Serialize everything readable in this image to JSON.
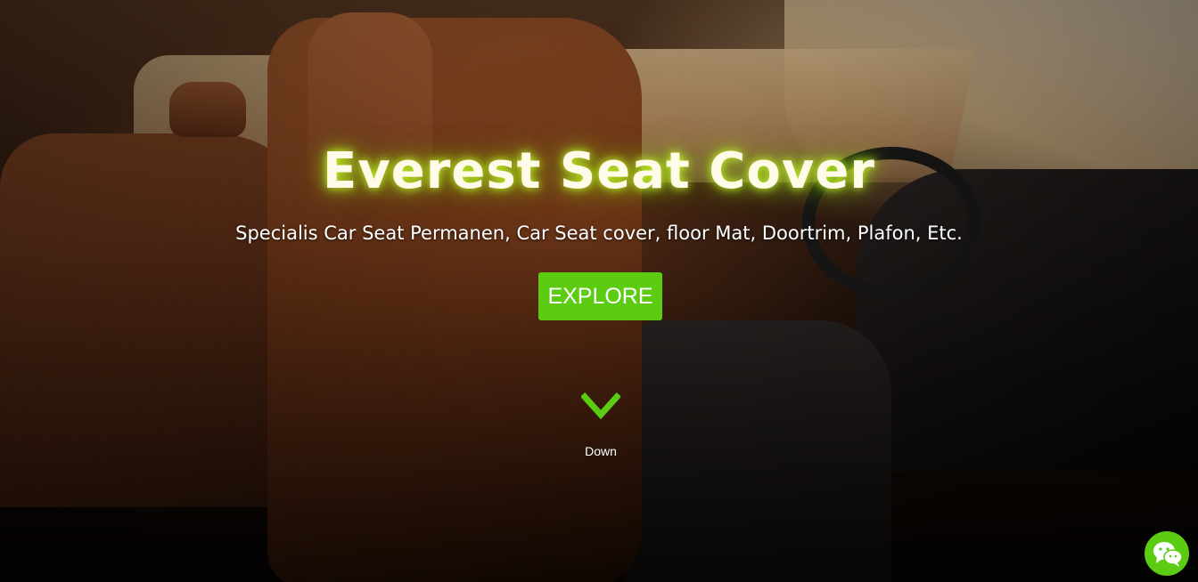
{
  "hero": {
    "title": "Everest Seat Cover",
    "subtitle": "Specialis Car Seat Permanen, Car Seat cover, floor Mat, Doortrim, Plafon, Etc.",
    "explore_label": "EXPLORE",
    "down_label": "Down",
    "background_description_icon": "car-interior-image"
  },
  "floating": {
    "chat_icon": "wechat-icon"
  },
  "colors": {
    "accent": "#5ccc13",
    "title_glow": "#c6ff28",
    "text": "#ffffff"
  }
}
